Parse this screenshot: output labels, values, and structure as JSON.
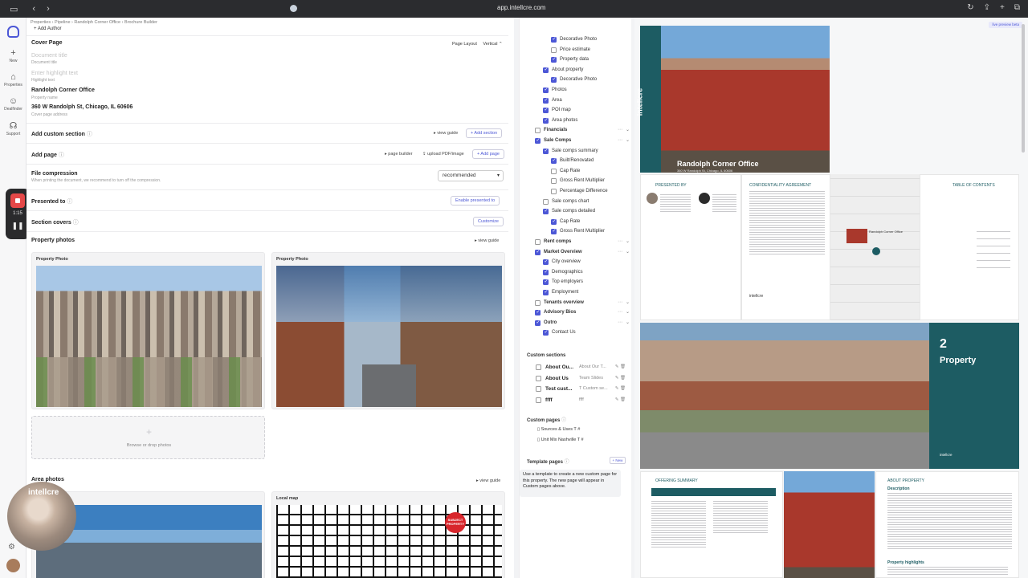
{
  "browser": {
    "url": "app.intellcre.com"
  },
  "nav": {
    "items": [
      {
        "icon": "plus-icon",
        "label": "New"
      },
      {
        "icon": "home-icon",
        "label": "Properties"
      },
      {
        "icon": "people-icon",
        "label": "Dealfinder"
      },
      {
        "icon": "headset-icon",
        "label": "Support"
      }
    ]
  },
  "recording": {
    "time": "1:15"
  },
  "webcam": {
    "brand": "intellcre"
  },
  "main": {
    "breadcrumb": "Properties  ›  Pipeline  ›  Randolph Corner Office  ›  Brochure Builder",
    "add_author": "+ Add Author",
    "cover_page": {
      "title": "Cover Page",
      "layout_label": "Page Layout",
      "layout_value": "Vertical ⌃",
      "doc_title_placeholder": "Document title",
      "doc_title_caption": "Document title",
      "highlight_placeholder": "Enter highlight text",
      "highlight_caption": "Highlight text",
      "property_name": "Randolph Corner Office",
      "property_name_caption": "Property name",
      "address": "360 W Randolph St, Chicago, IL 60606",
      "address_caption": "Cover page address"
    },
    "custom_section": {
      "title": "Add custom section",
      "view_guide": "view guide",
      "button": "+ Add section"
    },
    "add_page": {
      "title": "Add page",
      "page_builder": "page builder",
      "upload": "upload PDF/image",
      "button": "+ Add page"
    },
    "compression": {
      "title": "File compression",
      "caption": "When printing the document, we recommend to turn off the compression.",
      "value": "recommended"
    },
    "presented_to": {
      "title": "Presented to",
      "button": "Enable presented to"
    },
    "section_covers": {
      "title": "Section covers",
      "button": "Customize"
    },
    "property_photos": {
      "title": "Property photos",
      "view_guide": "view guide",
      "card_label": "Property Photo",
      "drop_text": "Browse or drop photos"
    },
    "area_photos": {
      "title": "Area photos",
      "view_guide": "view guide",
      "map_label": "Local map",
      "subject_pin": "SUBJECT PROPERTY"
    }
  },
  "panel": {
    "items": [
      {
        "label": "Decorative Photo",
        "checked": true,
        "level": 2
      },
      {
        "label": "Price estimate",
        "checked": false,
        "level": 2
      },
      {
        "label": "Property data",
        "checked": true,
        "level": 2
      },
      {
        "label": "About property",
        "checked": true,
        "level": 1
      },
      {
        "label": "Decorative Photo",
        "checked": true,
        "level": 2
      },
      {
        "label": "Photos",
        "checked": true,
        "level": 1
      },
      {
        "label": "Area",
        "checked": true,
        "level": 1
      },
      {
        "label": "POI map",
        "checked": true,
        "level": 1
      },
      {
        "label": "Area photos",
        "checked": true,
        "level": 1
      },
      {
        "label": "Financials",
        "checked": false,
        "level": 0
      },
      {
        "label": "Sale Comps",
        "checked": true,
        "level": 0
      },
      {
        "label": "Sale comps summary",
        "checked": true,
        "level": 1
      },
      {
        "label": "Built/Renovated",
        "checked": true,
        "level": 2
      },
      {
        "label": "Cap Rate",
        "checked": false,
        "level": 2
      },
      {
        "label": "Gross Rent Multiplier",
        "checked": false,
        "level": 2
      },
      {
        "label": "Percentage Difference",
        "checked": false,
        "level": 2
      },
      {
        "label": "Sale comps chart",
        "checked": false,
        "level": 1
      },
      {
        "label": "Sale comps detailed",
        "checked": true,
        "level": 1
      },
      {
        "label": "Cap Rate",
        "checked": true,
        "level": 2
      },
      {
        "label": "Gross Rent Multiplier",
        "checked": true,
        "level": 2
      },
      {
        "label": "Rent comps",
        "checked": false,
        "level": 0
      },
      {
        "label": "Market Overview",
        "checked": true,
        "level": 0
      },
      {
        "label": "City overview",
        "checked": true,
        "level": 1
      },
      {
        "label": "Demographics",
        "checked": true,
        "level": 1
      },
      {
        "label": "Top employers",
        "checked": true,
        "level": 1
      },
      {
        "label": "Employment",
        "checked": true,
        "level": 1
      },
      {
        "label": "Tenants overview",
        "checked": false,
        "level": 0
      },
      {
        "label": "Advisory Bios",
        "checked": true,
        "level": 0
      },
      {
        "label": "Outro",
        "checked": true,
        "level": 0
      },
      {
        "label": "Contact Us",
        "checked": true,
        "level": 1
      }
    ],
    "custom_sections_title": "Custom sections",
    "custom_sections": [
      {
        "name": "About Ou...",
        "desc": "About Our T..."
      },
      {
        "name": "About Us",
        "desc": "Team Slides"
      },
      {
        "name": "Test cust...",
        "desc": "T Custom se..."
      },
      {
        "name": "ffff",
        "desc": "ffff"
      }
    ],
    "custom_pages_title": "Custom pages",
    "custom_pages": [
      "Sources & Uses  T #",
      "Unit Mix Nashville  T #"
    ],
    "template_pages_title": "Template pages",
    "new_button": "+ New",
    "tooltip": "Use a template to create a new custom page for this property. The new page will appear in Custom pages above."
  },
  "preview": {
    "live_button": "live preview beta",
    "cover_brand": "intellcre",
    "cover_title": "Randolph Corner Office",
    "cover_address": "360 W Randolph St, Chicago, IL 60606",
    "presented_by": "PRESENTED BY",
    "confidentiality": "CONFIDENTIALITY AGREEMENT",
    "toc": "TABLE OF CONTENTS",
    "map_label": "Randolph Corner Office",
    "section_number": "2",
    "section_title": "Property",
    "offering_summary": "OFFERING SUMMARY",
    "about_property": "ABOUT PROPERTY",
    "description": "Description",
    "property_highlights": "Property highlights",
    "teal_brand": "intellcre"
  }
}
